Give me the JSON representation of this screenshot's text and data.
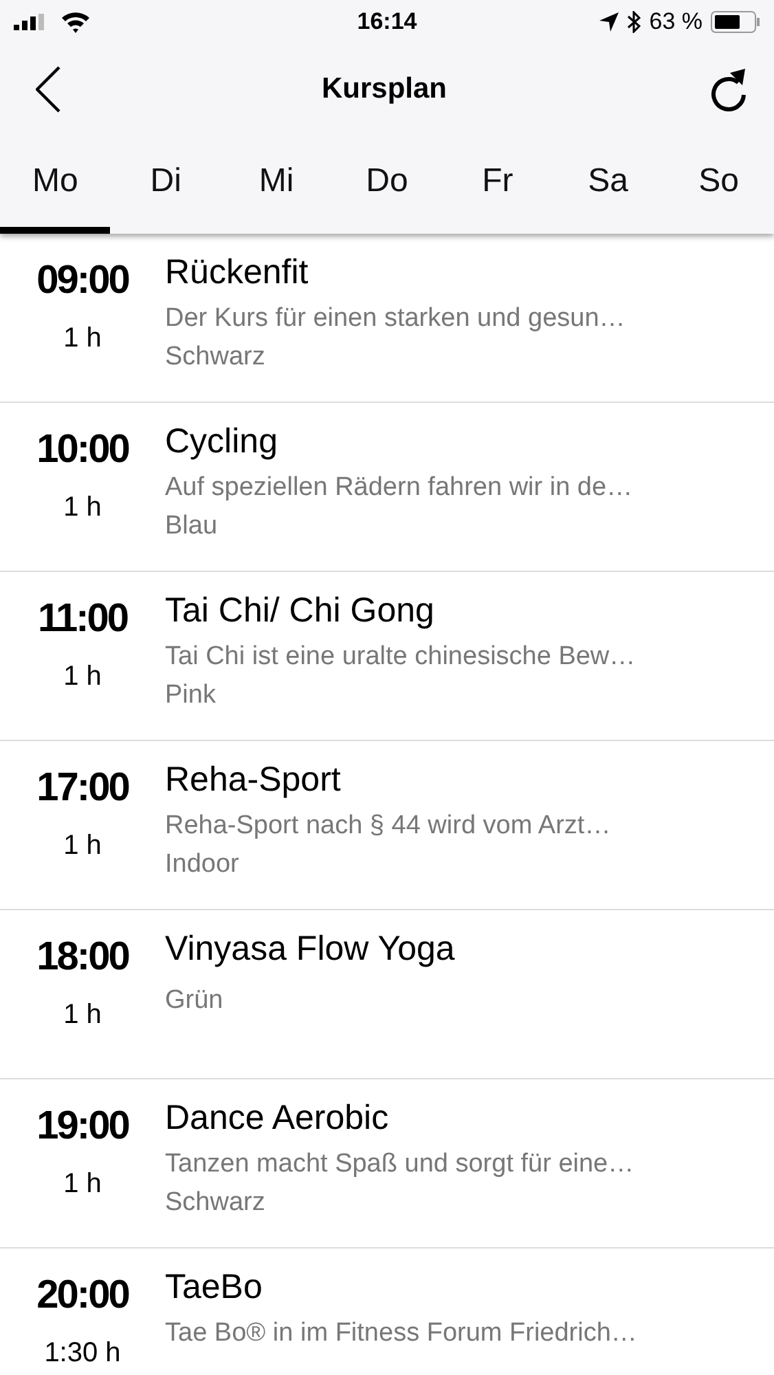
{
  "status_bar": {
    "time": "16:14",
    "battery": "63 %"
  },
  "nav": {
    "title": "Kursplan"
  },
  "tabs": [
    {
      "label": "Mo",
      "selected": true
    },
    {
      "label": "Di",
      "selected": false
    },
    {
      "label": "Mi",
      "selected": false
    },
    {
      "label": "Do",
      "selected": false
    },
    {
      "label": "Fr",
      "selected": false
    },
    {
      "label": "Sa",
      "selected": false
    },
    {
      "label": "So",
      "selected": false
    }
  ],
  "courses": [
    {
      "time": "09:00",
      "duration": "1 h",
      "title": "Rückenfit",
      "description": "Der Kurs für einen starken und gesun…",
      "room": "Schwarz"
    },
    {
      "time": "10:00",
      "duration": "1 h",
      "title": "Cycling",
      "description": "Auf speziellen Rädern fahren wir in de…",
      "room": "Blau"
    },
    {
      "time": "11:00",
      "duration": "1 h",
      "title": "Tai Chi/ Chi Gong",
      "description": "Tai Chi ist eine uralte chinesische Bew…",
      "room": "Pink"
    },
    {
      "time": "17:00",
      "duration": "1 h",
      "title": "Reha-Sport",
      "description": "Reha-Sport nach § 44 wird vom Arzt…",
      "room": "Indoor"
    },
    {
      "time": "18:00",
      "duration": "1 h",
      "title": "Vinyasa Flow Yoga",
      "room": "Grün"
    },
    {
      "time": "19:00",
      "duration": "1 h",
      "title": "Dance Aerobic",
      "description": "Tanzen macht Spaß und sorgt für eine…",
      "room": "Schwarz"
    },
    {
      "time": "20:00",
      "duration": "1:30 h",
      "title": "TaeBo",
      "description": "Tae Bo® in im Fitness Forum Friedrich…"
    }
  ]
}
